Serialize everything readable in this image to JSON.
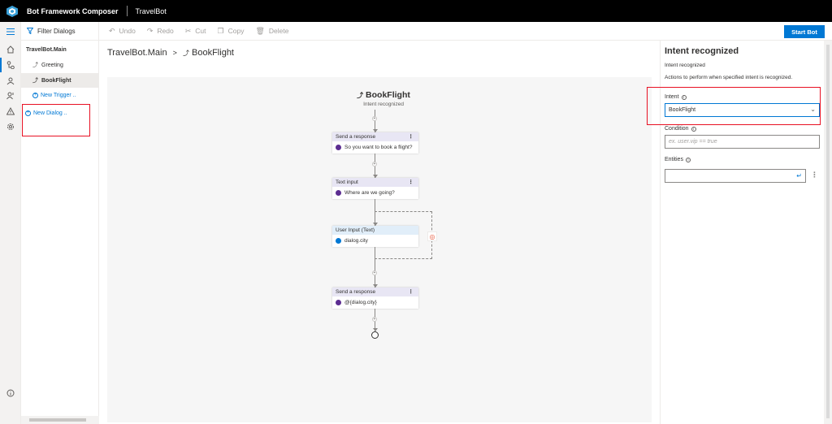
{
  "app": {
    "title": "Bot Framework Composer",
    "bot_name": "TravelBot"
  },
  "toolbar": {
    "filter_label": "Filter Dialogs",
    "undo": "Undo",
    "redo": "Redo",
    "cut": "Cut",
    "copy": "Copy",
    "delete": "Delete",
    "start_bot": "Start Bot"
  },
  "dialogs": {
    "root": "TravelBot.Main",
    "items": [
      {
        "label": "Greeting"
      },
      {
        "label": "BookFlight"
      }
    ],
    "new_trigger": "New Trigger ..",
    "new_dialog": "New Dialog .."
  },
  "breadcrumb": {
    "root": "TravelBot.Main",
    "separator": ">",
    "current": "BookFlight"
  },
  "flow": {
    "trigger_title": "BookFlight",
    "trigger_subtitle": "Intent recognized",
    "cards": [
      {
        "header": "Send a response",
        "body": "So you want to book a flight?"
      },
      {
        "header": "Text input",
        "body": "Where are we going?"
      },
      {
        "header": "User Input (Text)",
        "body": "dialog.city"
      },
      {
        "header": "Send a response",
        "body": "@{dialog.city}"
      }
    ]
  },
  "properties": {
    "title": "Intent recognized",
    "subtitle": "Intent recognized",
    "description": "Actions to perform when specified intent is recognized.",
    "intent_label": "Intent",
    "intent_value": "BookFlight",
    "condition_label": "Condition",
    "condition_placeholder": "ex. user.vip == true",
    "entities_label": "Entities"
  }
}
